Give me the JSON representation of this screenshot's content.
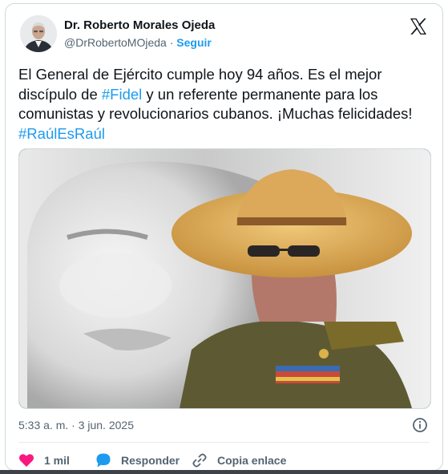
{
  "author": {
    "name": "Dr. Roberto Morales Ojeda",
    "handle": "@DrRobertoMOjeda",
    "separator": " · ",
    "follow_label": "Seguir"
  },
  "tweet": {
    "text_1": "El General de Ejército cumple hoy 94 años. Es el mejor discípulo de ",
    "hashtag_1": "#Fidel",
    "text_2": " y un referente permanente para los comunistas y revolucionarios cubanos. ¡Muchas felicidades! ",
    "hashtag_2": "#RaúlEsRaúl"
  },
  "meta": {
    "timestamp": "5:33 a. m. · 3 jun. 2025"
  },
  "actions": {
    "likes_count": "1 mil",
    "reply_label": "Responder",
    "copy_link_label": "Copia enlace"
  },
  "colors": {
    "accent": "#1d9bf0",
    "like": "#f91880",
    "text": "#0f1419",
    "muted": "#536471"
  },
  "icons": {
    "brand": "x-logo-icon",
    "info": "info-icon",
    "like": "heart-icon",
    "reply": "speech-bubble-icon",
    "copy": "link-icon"
  }
}
